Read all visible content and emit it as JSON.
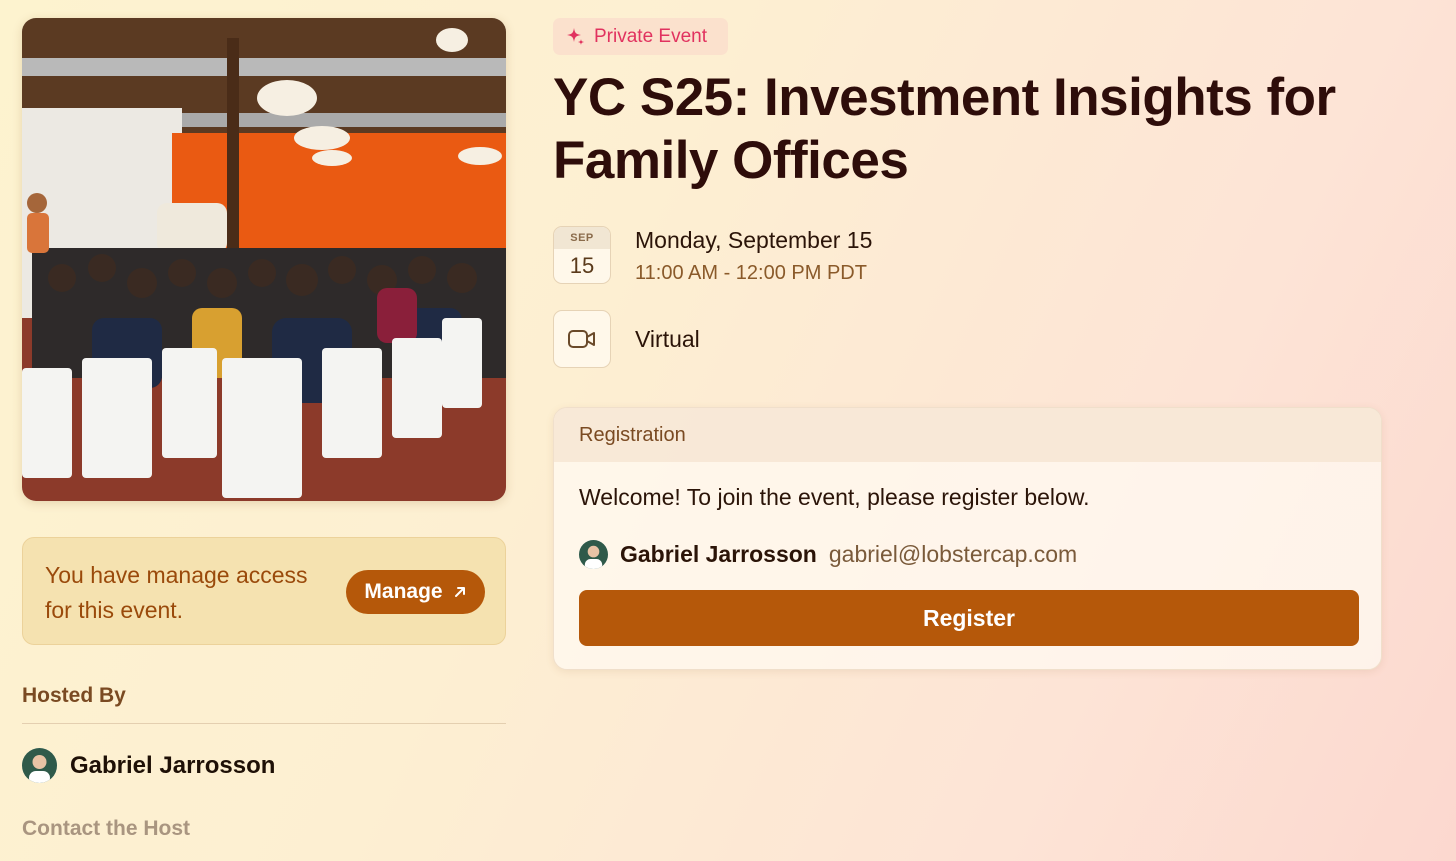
{
  "cover_image": {
    "icon": "event-photo-audience"
  },
  "manage": {
    "text": "You have manage access for this event.",
    "button_label": "Manage",
    "button_icon": "arrow-up-right-icon"
  },
  "hosts": {
    "label": "Hosted By",
    "host_name": "Gabriel Jarrosson",
    "contact_label": "Contact the Host"
  },
  "event": {
    "badge": "Private Event",
    "badge_icon": "sparkle-icon",
    "title": "YC S25: Investment Insights for Family Offices",
    "date_month": "SEP",
    "date_day": "15",
    "date_full": "Monday, September 15",
    "time_range": "11:00 AM - 12:00 PM PDT",
    "location_icon": "video-camera-icon",
    "location": "Virtual"
  },
  "registration": {
    "heading": "Registration",
    "welcome": "Welcome! To join the event, please register below.",
    "user_name": "Gabriel Jarrosson",
    "user_email": "gabriel@lobstercap.com",
    "button_label": "Register"
  },
  "colors": {
    "accent": "#b5580a",
    "badge_text": "#e1325f",
    "title": "#2e0d0a"
  }
}
